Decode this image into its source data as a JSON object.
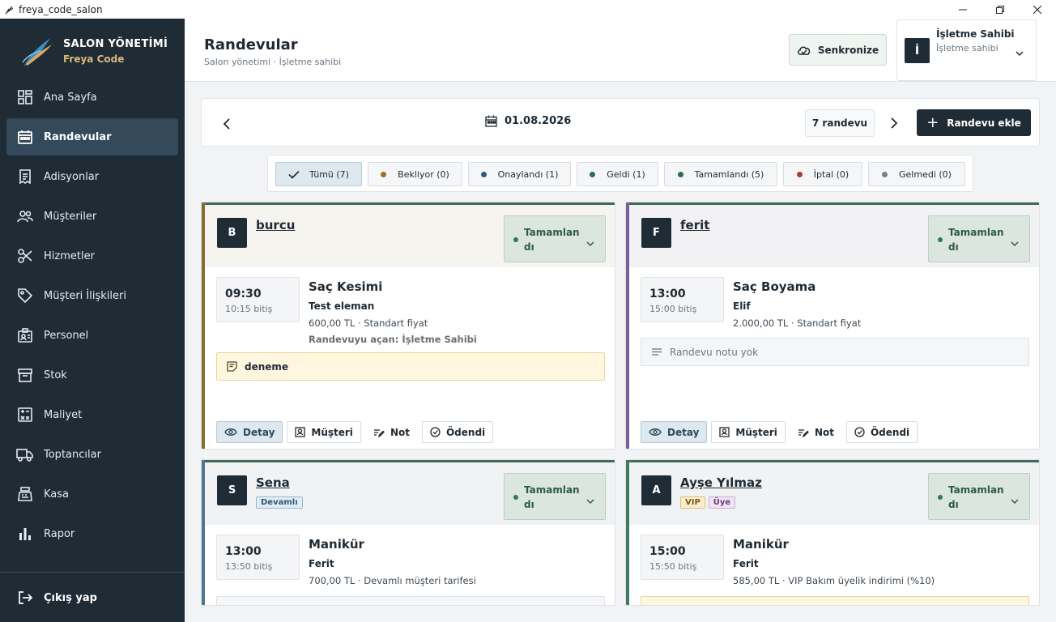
{
  "window": {
    "title": "freya_code_salon"
  },
  "brand": {
    "title": "SALON YÖNETİMİ",
    "subtitle": "Freya Code"
  },
  "nav": [
    {
      "label": "Ana Sayfa",
      "icon": "dashboard-icon"
    },
    {
      "label": "Randevular",
      "icon": "calendar-icon",
      "active": true
    },
    {
      "label": "Adisyonlar",
      "icon": "receipt-icon"
    },
    {
      "label": "Müşteriler",
      "icon": "users-icon"
    },
    {
      "label": "Hizmetler",
      "icon": "scissors-icon"
    },
    {
      "label": "Müşteri İlişkileri",
      "icon": "tag-icon"
    },
    {
      "label": "Personel",
      "icon": "id-card-icon"
    },
    {
      "label": "Stok",
      "icon": "box-icon"
    },
    {
      "label": "Maliyet",
      "icon": "calculator-icon"
    },
    {
      "label": "Toptancılar",
      "icon": "truck-icon"
    },
    {
      "label": "Kasa",
      "icon": "cash-register-icon"
    },
    {
      "label": "Rapor",
      "icon": "bar-chart-icon"
    }
  ],
  "logout_label": "Çıkış yap",
  "header": {
    "title": "Randevular",
    "subtitle": "Salon yönetimi · İşletme sahibi",
    "sync_label": "Senkronize",
    "user_initial": "İ",
    "user_name": "İşletme Sahibi",
    "user_role": "İşletme sahibi"
  },
  "datebar": {
    "date": "01.08.2026",
    "count": "7 randevu",
    "add_label": "Randevu ekle"
  },
  "filters": [
    {
      "label": "Tümü (7)",
      "active": true
    },
    {
      "label": "Bekliyor (0)",
      "color": "#a0702a"
    },
    {
      "label": "Onaylandı (1)",
      "color": "#2f5b7c"
    },
    {
      "label": "Geldi (1)",
      "color": "#2e6b54"
    },
    {
      "label": "Tamamlandı (5)",
      "color": "#2e6b54"
    },
    {
      "label": "İptal (0)",
      "color": "#b03a3a"
    },
    {
      "label": "Gelmedi (0)",
      "color": "#7a7f84"
    }
  ],
  "cards": [
    {
      "initial": "B",
      "name": "burcu",
      "tags": [],
      "accent": "#8a6a2e",
      "head_bg": "#f6f4ee",
      "top": "#3f6b58",
      "status": "Tamamlan dı",
      "time_start": "09:30",
      "time_end": "10:15 bitiş",
      "service": "Saç Kesimi",
      "staff": "Test eleman",
      "price": "600,00 TL · Standart fiyat",
      "opener": "Randevuyu açan: İşletme Sahibi",
      "note": "deneme",
      "note_empty": false
    },
    {
      "initial": "F",
      "name": "ferit",
      "tags": [],
      "accent": "#7a5f9a",
      "head_bg": "#f2f2f5",
      "top": "#3f6b58",
      "status": "Tamamlan dı",
      "time_start": "13:00",
      "time_end": "15:00 bitiş",
      "service": "Saç Boyama",
      "staff": "Elif",
      "price": "2.000,00 TL · Standart fiyat",
      "opener": "",
      "note": "Randevu notu yok",
      "note_empty": true
    },
    {
      "initial": "S",
      "name": "Sena",
      "tags": [
        {
          "label": "Devamlı",
          "bg": "#e1ecf4",
          "border": "#9ab8cf",
          "color": "#2c5a7a"
        }
      ],
      "accent": "#4f7591",
      "head_bg": "#f0f2f3",
      "top": "#3f6b58",
      "status": "Tamamlan dı",
      "time_start": "13:00",
      "time_end": "13:50 bitiş",
      "service": "Manikür",
      "staff": "Ferit",
      "price": "700,00 TL · Devamlı müşteri tarifesi",
      "opener": "",
      "note": "",
      "note_empty": true
    },
    {
      "initial": "A",
      "name": "Ayşe Yılmaz",
      "tags": [
        {
          "label": "VIP",
          "bg": "#fbeed0",
          "border": "#dcc07a",
          "color": "#7a5a16"
        },
        {
          "label": "Üye",
          "bg": "#efe4f3",
          "border": "#c8aed5",
          "color": "#6a3e7e"
        }
      ],
      "accent": "#3e7a5e",
      "head_bg": "#f0f2f3",
      "top": "#3f6b58",
      "status": "Tamamlan dı",
      "time_start": "15:00",
      "time_end": "15:50 bitiş",
      "service": "Manikür",
      "staff": "Ferit",
      "price": "585,00 TL · VIP Bakım üyelik indirimi (%10)",
      "opener": "",
      "note": "",
      "note_empty": false
    }
  ],
  "actions": {
    "detail": "Detay",
    "customer": "Müşteri",
    "note": "Not",
    "paid": "Ödendi"
  }
}
